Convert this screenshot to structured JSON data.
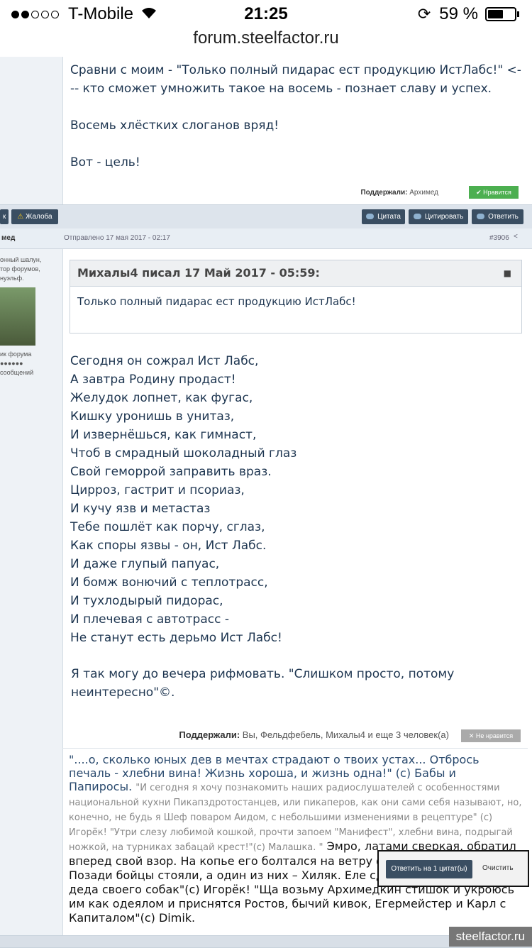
{
  "status_bar": {
    "carrier": "T-Mobile",
    "time": "21:25",
    "battery_percent": "59 %",
    "signal_dots_filled": 2,
    "signal_dots_total": 5,
    "battery_level": 0.59
  },
  "browser": {
    "url": "forum.steelfactor.ru"
  },
  "post1": {
    "text": [
      "Сравни с моим - \"Только полный пидарас ест продукцию ИстЛабс!\" <--- кто сможет умножить такое на восемь - познает славу и успех.",
      "Восемь хлёстких слоганов вряд!",
      "Вот - цель!"
    ],
    "supported_label": "Поддержали:",
    "supported_by": "Архимед",
    "like_label": "Нравится"
  },
  "actions_bar": {
    "left_partial": "к",
    "report": "Жалоба",
    "quote": "Цитата",
    "cite": "Цитировать",
    "reply": "Ответить"
  },
  "post2": {
    "author_partial": "мед",
    "sent": "Отправлено 17 мая 2017 - 02:17",
    "number": "#3906",
    "sidebar": {
      "status_lines": [
        "онный шалун,",
        "тор форумов,",
        "нуэльф."
      ],
      "rank": "ик форума",
      "dots": "●●●●●●",
      "posts": "сообщений"
    },
    "quote_header": "Михалы4 писал 17 Май 2017 - 05:59:",
    "quote_text": "Только полный пидарас ест продукцию ИстЛабс!",
    "poem": [
      "Сегодня он сожрал Ист Лабс,",
      "А завтра Родину продаст!",
      "Желудок лопнет, как фугас,",
      "Кишку уронишь в унитаз,",
      "И извернёшься, как гимнаст,",
      "Чтоб в смрадный шоколадный глаз",
      "Свой геморрой заправить враз.",
      "Цирроз, гастрит и псориаз,",
      "И кучу язв и метастаз",
      "Тебе пошлёт как порчу, сглаз,",
      "Как споры язвы - он, Ист Лабс.",
      "И даже глупый папуас,",
      "И бомж вонючий с теплотрасс,",
      "И тухлодырый пидорас,",
      "И плечевая с автотрасс -",
      "Не станут есть дерьмо Ист Лабс!"
    ],
    "extra": " Я так могу до вечера рифмовать. \"Слишком просто, потому неинтересно\"©.",
    "supported_label": "Поддержали:",
    "supported_by": "Вы, Фельдфебель, Михалы4 и еще 3 человек(а)",
    "unlike_label": "Не нравится"
  },
  "signature": {
    "part_a": "\"....о, сколько юных дев в мечтах страдают о твоих устах... Отбрось печаль - хлебни вина! Жизнь хороша, и жизнь одна!\" (с) Бабы и Папиросы.",
    "part_b": "\"И сегодня я хочу познакомить наших радиослушателей с  особенностями национальной кухни Пикапздротостанцев, или пикаперов, как они сами себя называют, но, конечно,  не будь я Шеф поваром Аидом, с небольшими изменениями в рецептуре\" (с) Игорёк! \"Утри слезу любимой кошкой, прочти запоем \"Манифест\", хлебни вина, подрыгай ножкой, на турниках забацай крест!\"(с) Малашка. \"",
    "part_c": "Эмро, латами сверкая, обратил вперед свой взор. На копье его болтался на ветру флажком Сеньор! Позади бойцы стояли, а один из них – Хиляк. Еле сдерживал свирепых деда своего собак\"(с) Игорёк!",
    "part_d": "\"Ща возьму Архимедкин стишок и укроюсь им как одеялом и приснятся Ростов, бычий кивок, Егермейстер и Карл с Капиталом\"(с) Dimik."
  },
  "reply_popup": {
    "reply_quotes": "Ответить на 1 цитат(ы)",
    "clear": "Очистить"
  },
  "watermark": "steelfactor.ru",
  "colors": {
    "like_green": "#4caf50",
    "button_dark": "#3a4e62",
    "link_blue": "#2a4a6e"
  }
}
